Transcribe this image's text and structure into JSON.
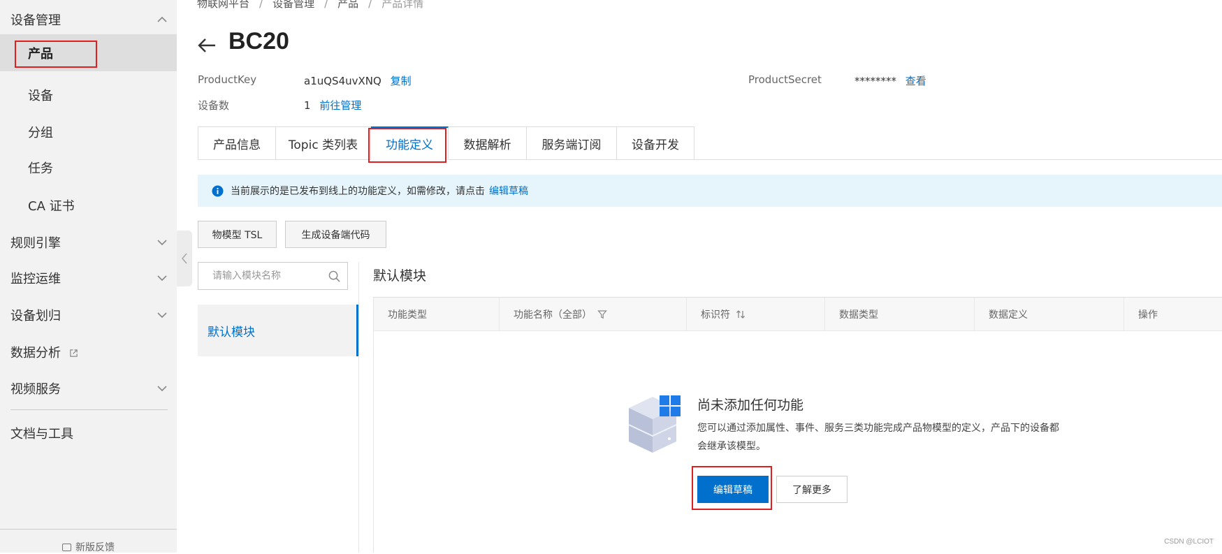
{
  "sidebar": {
    "items": [
      {
        "label": "设备管理",
        "icon": "chevron-up-icon"
      },
      {
        "label": "产品"
      },
      {
        "label": "设备"
      },
      {
        "label": "分组"
      },
      {
        "label": "任务"
      },
      {
        "label": "CA 证书"
      },
      {
        "label": "规则引擎",
        "icon": "chevron-down-icon"
      },
      {
        "label": "监控运维",
        "icon": "chevron-down-icon"
      },
      {
        "label": "设备划归",
        "icon": "chevron-down-icon"
      },
      {
        "label": "数据分析",
        "icon": "external-link-icon"
      },
      {
        "label": "视频服务",
        "icon": "chevron-down-icon"
      },
      {
        "label": "文档与工具"
      }
    ],
    "feedback": "新版反馈"
  },
  "breadcrumb": [
    "物联网平台",
    "设备管理",
    "产品",
    "产品详情"
  ],
  "page": {
    "title": "BC20"
  },
  "meta": {
    "product_key_label": "ProductKey",
    "product_key_value": "a1uQS4uvXNQ",
    "copy_link": "复制",
    "product_secret_label": "ProductSecret",
    "product_secret_value": "********",
    "view_link": "查看",
    "device_count_label": "设备数",
    "device_count_value": "1",
    "manage_link": "前往管理"
  },
  "tabs": [
    {
      "label": "产品信息"
    },
    {
      "label": "Topic 类列表"
    },
    {
      "label": "功能定义",
      "active": true
    },
    {
      "label": "数据解析"
    },
    {
      "label": "服务端订阅"
    },
    {
      "label": "设备开发"
    }
  ],
  "notice": {
    "text": "当前展示的是已发布到线上的功能定义，如需修改，请点击",
    "link": "编辑草稿"
  },
  "toolbar": {
    "tsl_button": "物模型 TSL",
    "gen_code_button": "生成设备端代码"
  },
  "module_search": {
    "placeholder": "请输入模块名称"
  },
  "modules": [
    {
      "label": "默认模块"
    }
  ],
  "section_title": "默认模块",
  "table": {
    "headers": [
      "功能类型",
      "功能名称（全部）",
      "标识符",
      "数据类型",
      "数据定义",
      "操作"
    ]
  },
  "empty_state": {
    "title": "尚未添加任何功能",
    "description": "您可以通过添加属性、事件、服务三类功能完成产品物模型的定义，产品下的设备都会继承该模型。",
    "primary_button": "编辑草稿",
    "secondary_button": "了解更多"
  },
  "watermark": "CSDN @LCIOT",
  "colors": {
    "accent": "#0070cc",
    "highlight_box": "#e02020",
    "notice_bg": "#e6f4fc"
  }
}
